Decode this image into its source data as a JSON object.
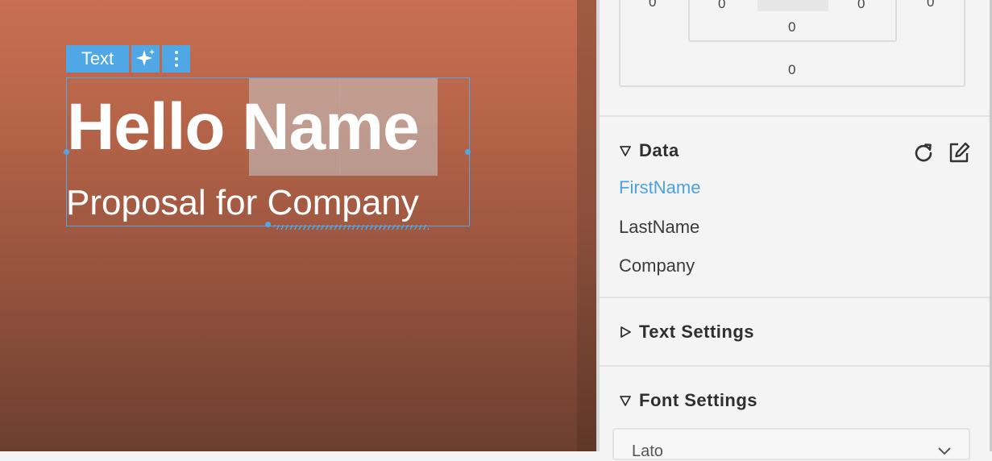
{
  "canvas": {
    "toolbar": {
      "label": "Text",
      "ai_icon": "sparkle-icon",
      "more_icon": "more-vertical-icon"
    },
    "heading_first": "Hello ",
    "heading_token": "Name",
    "subheading": "Proposal for Company"
  },
  "panel": {
    "spacing": {
      "outer_left": "0",
      "inner_left": "0",
      "inner_right": "0",
      "outer_right": "0",
      "inner_bottom": "0",
      "outer_bottom": "0"
    },
    "data_section": {
      "title": "Data",
      "refresh_icon": "refresh-icon",
      "edit_icon": "edit-icon",
      "items": [
        {
          "label": "FirstName",
          "active": true
        },
        {
          "label": "LastName",
          "active": false
        },
        {
          "label": "Company",
          "active": false
        }
      ]
    },
    "text_settings": {
      "title": "Text Settings"
    },
    "font_settings": {
      "title": "Font Settings",
      "font_value": "Lato"
    }
  },
  "colors": {
    "accent": "#4fa7e6",
    "active_item": "#4aa3e0",
    "canvas_top": "#c96f52",
    "canvas_bottom": "#6c3f2f"
  }
}
